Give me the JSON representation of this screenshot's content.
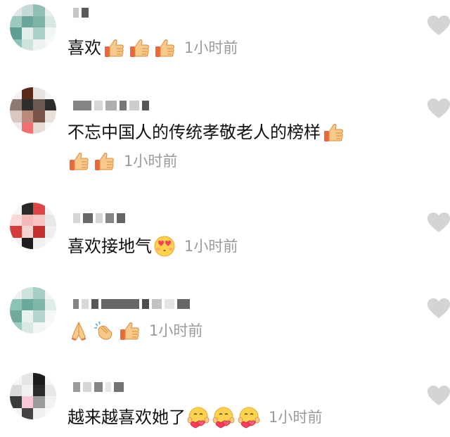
{
  "comments": [
    {
      "text": "喜欢",
      "emojis": [
        "thumbs-up",
        "thumbs-up",
        "thumbs-up"
      ],
      "time": "1小时前"
    },
    {
      "text": "不忘中国人的传统孝敬老人的榜样",
      "emojis_line1": [
        "thumbs-up"
      ],
      "emojis_line2": [
        "thumbs-up",
        "thumbs-up"
      ],
      "time": "1小时前"
    },
    {
      "text": "喜欢接地气",
      "emojis": [
        "heart-eyes-kiss"
      ],
      "time": "1小时前"
    },
    {
      "text": "",
      "emojis": [
        "folded-hands",
        "clapping-hands",
        "thumbs-up"
      ],
      "time": "1小时前"
    },
    {
      "text": "越来越喜欢她了",
      "emojis": [
        "heart-hug-face",
        "heart-hug-face",
        "heart-hug-face"
      ],
      "time": "1小时前"
    }
  ],
  "colors": {
    "text": "#111111",
    "timestamp": "#9a9a9a",
    "like_icon": "#d4d4d4"
  }
}
